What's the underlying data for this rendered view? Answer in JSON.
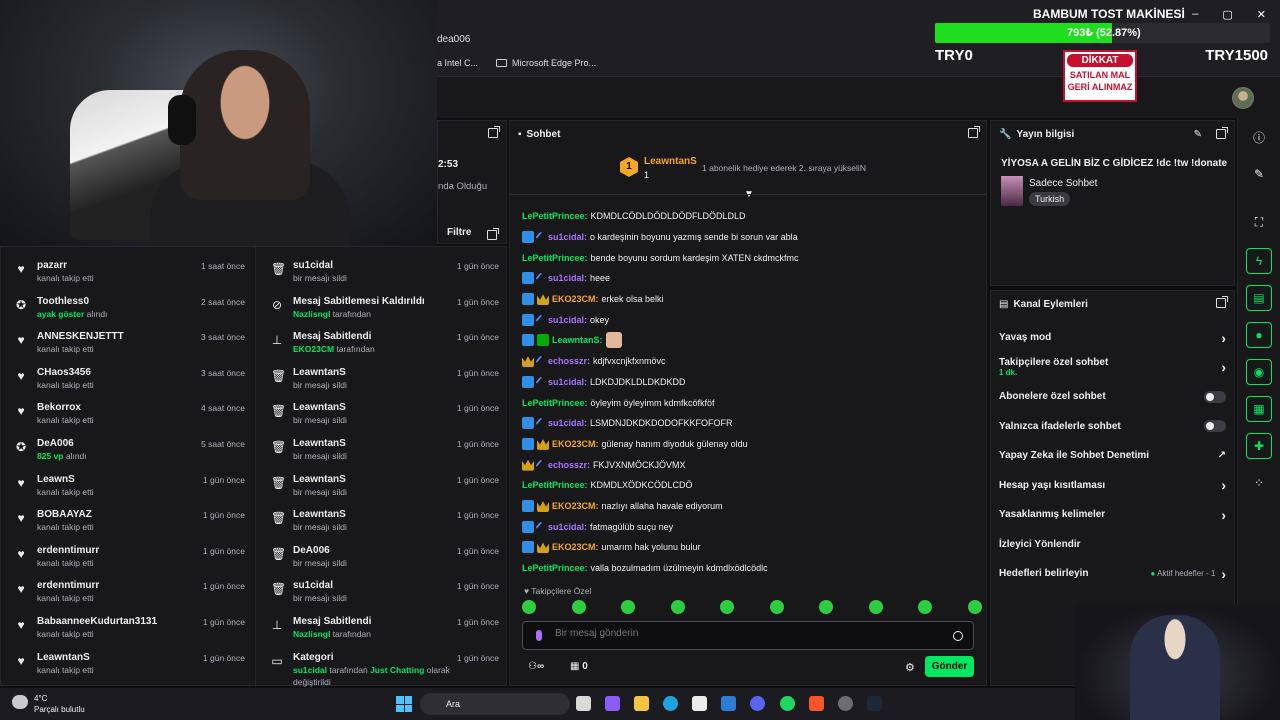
{
  "browser": {
    "address": "dea006",
    "bookmarks": [
      "a Intel C...",
      "Microsoft Edge Pro..."
    ]
  },
  "donation": {
    "title": "BAMBUM TOST MAKİNESİ",
    "progress_text": "793₺ (52.87%)",
    "progress_fraction": 0.5287,
    "min": "TRY0",
    "max": "TRY1500",
    "sign": {
      "head": "DİKKAT",
      "line1": "SATILAN MAL",
      "line2": "GERİ ALINMAZ"
    }
  },
  "stream_panel": {
    "time_fragment": "2:53",
    "text_fragment": "nda Olduğu",
    "filter_label": "Filtre"
  },
  "activity_left": [
    {
      "icon": "heart",
      "name": "pazarr",
      "sub": "kanalı takip etti",
      "time": "1 saat önce"
    },
    {
      "icon": "gift",
      "name": "Toothless0",
      "sub_hl": "ayak göster",
      "sub": "alındı",
      "time": "2 saat önce"
    },
    {
      "icon": "heart",
      "name": "ANNESKENJETTT",
      "sub": "kanalı takip etti",
      "time": "3 saat önce"
    },
    {
      "icon": "heart",
      "name": "CHaos3456",
      "sub": "kanalı takip etti",
      "time": "3 saat önce"
    },
    {
      "icon": "heart",
      "name": "Bekorrox",
      "sub": "kanalı takip etti",
      "time": "4 saat önce"
    },
    {
      "icon": "gift",
      "name": "DeA006",
      "sub_hl": "825 vp",
      "sub": "alındı",
      "time": "5 saat önce"
    },
    {
      "icon": "heart",
      "name": "LeawnS",
      "sub": "kanalı takip etti",
      "time": "1 gün önce"
    },
    {
      "icon": "heart",
      "name": "BOBAAYAZ",
      "sub": "kanalı takip etti",
      "time": "1 gün önce"
    },
    {
      "icon": "heart",
      "name": "erdenntimurr",
      "sub": "kanalı takip etti",
      "time": "1 gün önce"
    },
    {
      "icon": "heart",
      "name": "erdenntimurr",
      "sub": "kanalı takip etti",
      "time": "1 gün önce"
    },
    {
      "icon": "heart",
      "name": "BabaanneeKudurtan3131",
      "sub": "kanalı takip etti",
      "time": "1 gün önce"
    },
    {
      "icon": "heart",
      "name": "LeawntanS",
      "sub": "kanalı takip etti",
      "time": "1 gün önce"
    }
  ],
  "activity_right": [
    {
      "icon": "trash",
      "name": "su1cidal",
      "sub": "bir mesajı sildi",
      "time": "1 gün önce"
    },
    {
      "icon": "unpin",
      "name": "Mesaj Sabitlemesi Kaldırıldı",
      "sub_hl": "Nazlisngl",
      "sub": "tarafından",
      "time": "1 gün önce"
    },
    {
      "icon": "pin",
      "name": "Mesaj Sabitlendi",
      "sub_hl": "EKO23CM",
      "sub": "tarafından",
      "time": "1 gün önce"
    },
    {
      "icon": "trash",
      "name": "LeawntanS",
      "sub": "bir mesajı sildi",
      "time": "1 gün önce"
    },
    {
      "icon": "trash",
      "name": "LeawntanS",
      "sub": "bir mesajı sildi",
      "time": "1 gün önce"
    },
    {
      "icon": "trash",
      "name": "LeawntanS",
      "sub": "bir mesajı sildi",
      "time": "1 gün önce"
    },
    {
      "icon": "trash",
      "name": "LeawntanS",
      "sub": "bir mesajı sildi",
      "time": "1 gün önce"
    },
    {
      "icon": "trash",
      "name": "LeawntanS",
      "sub": "bir mesajı sildi",
      "time": "1 gün önce"
    },
    {
      "icon": "trash",
      "name": "DeA006",
      "sub": "bir mesajı sildi",
      "time": "1 gün önce"
    },
    {
      "icon": "trash",
      "name": "su1cidal",
      "sub": "bir mesajı sildi",
      "time": "1 gün önce"
    },
    {
      "icon": "pin",
      "name": "Mesaj Sabitlendi",
      "sub_hl": "Nazlisngl",
      "sub": "tarafından",
      "time": "1 gün önce"
    },
    {
      "icon": "category",
      "name": "Kategori",
      "sub_hl": "su1cidal",
      "sub": "tarafından",
      "sub_hl2": "Just Chatting",
      "sub2": "olarak değiştirildi",
      "time": "1 gün önce"
    }
  ],
  "chat": {
    "title": "Sohbet",
    "pinned_user": "LeawntanS",
    "pinned_rank": "1",
    "pinned_count": "1",
    "pinned_text": "1 abonelik hediye ederek 2. sıraya yükseliN",
    "messages": [
      {
        "badges": [],
        "user": "LePetitPrincee",
        "color": "#00e861",
        "text": "KDMDLCÖDLDÖDLDÖDFLDÖDLDLD"
      },
      {
        "badges": [
          "blue",
          "wand"
        ],
        "user": "su1cidal",
        "color": "#a970ff",
        "text": "o kardeşinin boyunu yazmış sende bi sorun var abla"
      },
      {
        "badges": [],
        "user": "LePetitPrincee",
        "color": "#00e861",
        "text": "bende boyunu sordum kardeşim XATEN ckdmckfmc"
      },
      {
        "badges": [
          "blue",
          "wand"
        ],
        "user": "su1cidal",
        "color": "#a970ff",
        "text": "heee"
      },
      {
        "badges": [
          "blue",
          "gold"
        ],
        "user": "EKO23CM",
        "color": "#f5a623",
        "text": "erkek olsa belki"
      },
      {
        "badges": [
          "blue",
          "wand"
        ],
        "user": "su1cidal",
        "color": "#a970ff",
        "text": "okey"
      },
      {
        "badges": [
          "blue",
          "green"
        ],
        "user": "LeawntanS",
        "color": "#00e861",
        "text": ""
      },
      {
        "badges": [
          "gold",
          "wand"
        ],
        "user": "echosszr",
        "color": "#a970ff",
        "text": "kdjfvxcnjkfxnmövc"
      },
      {
        "badges": [
          "blue",
          "wand"
        ],
        "user": "su1cidal",
        "color": "#a970ff",
        "text": "LDKDJDKLDLDKDKDD"
      },
      {
        "badges": [],
        "user": "LePetitPrincee",
        "color": "#00e861",
        "text": "öyleyim öyleyimm kdmfkcöfkföf"
      },
      {
        "badges": [
          "blue",
          "wand"
        ],
        "user": "su1cidal",
        "color": "#a970ff",
        "text": "LSMDNJDKDKDODOFKKFOFOFR"
      },
      {
        "badges": [
          "blue",
          "gold"
        ],
        "user": "EKO23CM",
        "color": "#f5a623",
        "text": "gülenay hanım diyoduk gülenay oldu"
      },
      {
        "badges": [
          "gold",
          "wand"
        ],
        "user": "echosszr",
        "color": "#a970ff",
        "text": "FKJVXNMÖCKJÖVMX"
      },
      {
        "badges": [],
        "user": "LePetitPrincee",
        "color": "#00e861",
        "text": "KDMDLXÖDKCÖDLCDÖ"
      },
      {
        "badges": [
          "blue",
          "gold"
        ],
        "user": "EKO23CM",
        "color": "#f5a623",
        "text": "nazlıyı allaha havale ediyorum"
      },
      {
        "badges": [
          "blue",
          "wand"
        ],
        "user": "su1cidal",
        "color": "#a970ff",
        "text": "fatmagülüb suçu ney"
      },
      {
        "badges": [
          "blue",
          "gold"
        ],
        "user": "EKO23CM",
        "color": "#f5a623",
        "text": "umarım hak yolunu bulur"
      },
      {
        "badges": [],
        "user": "LePetitPrincee",
        "color": "#00e861",
        "text": "valla bozulmadım üzülmeyin kdmdlxödlcödlc"
      }
    ],
    "followers_only": "Takipçilere Özel",
    "input_placeholder": "Bir mesaj gönderin",
    "points": "0",
    "send_label": "Gönder"
  },
  "stream_info": {
    "title": "Yayın bilgisi",
    "stream_title": "YİYOSA A GELİN BİZ C GİDİCEZ !dc !tw !donate",
    "category": "Sadece Sohbet",
    "language": "Turkish"
  },
  "channel_actions": {
    "title": "Kanal Eylemleri",
    "items": [
      {
        "label": "Yavaş mod",
        "control": "chevron"
      },
      {
        "label": "Takipçilere özel sohbet",
        "sub": "1 dk.",
        "control": "chevron"
      },
      {
        "label": "Abonelere özel sohbet",
        "control": "toggle"
      },
      {
        "label": "Yalnızca ifadelerle sohbet",
        "control": "toggle"
      },
      {
        "label": "Yapay Zeka ile Sohbet Denetimi",
        "control": "external"
      },
      {
        "label": "Hesap yaşı kısıtlaması",
        "control": "chevron"
      },
      {
        "label": "Yasaklanmış kelimeler",
        "control": "chevron"
      },
      {
        "label": "İzleyici Yönlendir",
        "control": "none"
      },
      {
        "label": "Hedefleri belirleyin",
        "extra": "Aktif hedefler - 1",
        "control": "chevron"
      }
    ]
  },
  "taskbar": {
    "temp": "4°C",
    "weather": "Parçalı bulutlu",
    "search": "Ara"
  },
  "colors": {
    "accent": "#00e861",
    "bg": "#18181b",
    "purple": "#a970ff"
  }
}
